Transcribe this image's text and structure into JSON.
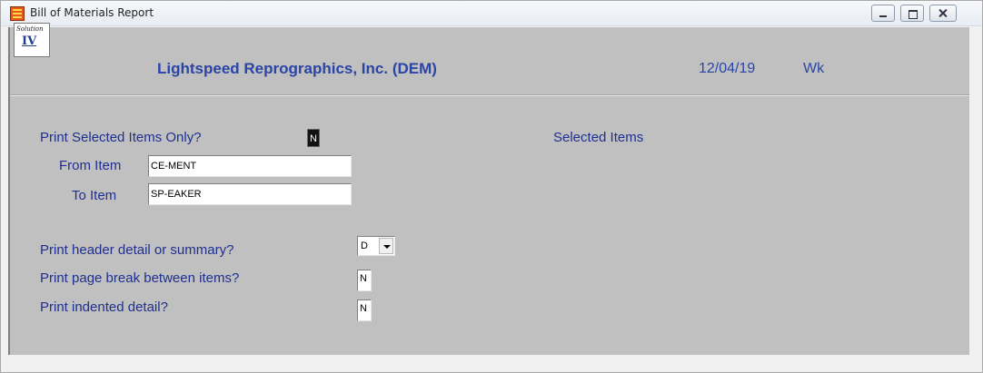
{
  "window": {
    "title": "Bill of Materials Report"
  },
  "header": {
    "logo_top": "Solution",
    "logo_bottom": "IV",
    "company": "Lightspeed Reprographics, Inc. (DEM)",
    "date": "12/04/19",
    "wk": "Wk"
  },
  "form": {
    "print_selected_label": "Print Selected Items Only?",
    "print_selected_value": "N",
    "from_item_label": "From Item",
    "from_item_value": "CE-MENT",
    "to_item_label": "To Item",
    "to_item_value": "SP-EAKER",
    "selected_items_label": "Selected Items",
    "header_detail_label": "Print header detail or summary?",
    "header_detail_value": "D",
    "page_break_label": "Print page break between items?",
    "page_break_value": "N",
    "indented_label": "Print indented detail?",
    "indented_value": "N"
  },
  "icons": {
    "app": "report-icon",
    "minimize": "minimize-icon",
    "maximize": "maximize-icon",
    "close": "close-icon"
  }
}
